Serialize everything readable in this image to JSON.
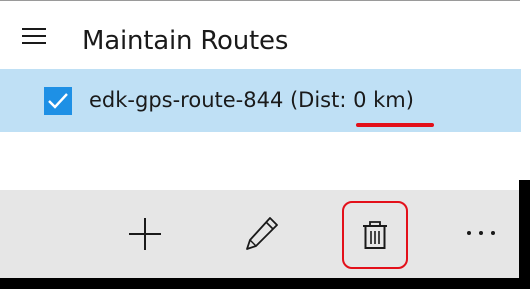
{
  "header": {
    "title": "Maintain Routes",
    "menu_icon": "hamburger-menu-icon"
  },
  "routes": [
    {
      "label": "edk-gps-route-844 (Dist: 0 km)",
      "checked": true,
      "highlight_color": "#bfe0f5",
      "checkbox_color": "#1e90e5"
    }
  ],
  "toolbar": {
    "background": "#e6e6e6",
    "buttons": [
      {
        "icon": "add-icon"
      },
      {
        "icon": "edit-pencil-icon"
      },
      {
        "icon": "delete-trash-icon"
      },
      {
        "icon": "more-options-icon"
      }
    ]
  },
  "annotations": {
    "color": "#e3101a",
    "marks": [
      "underline-distance",
      "circle-delete-button"
    ]
  }
}
